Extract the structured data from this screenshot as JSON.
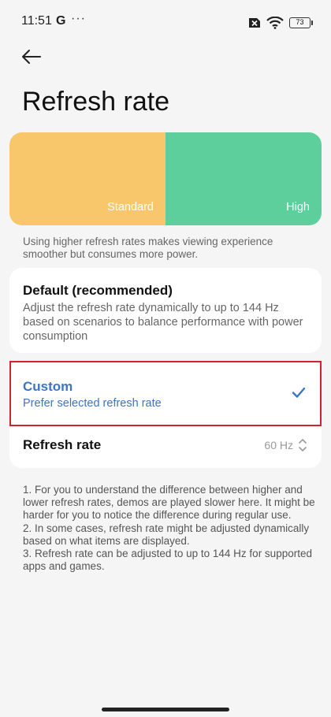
{
  "status_bar": {
    "time": "11:51",
    "google_letter": "G",
    "more": "···",
    "battery_level": "73"
  },
  "header": {
    "title": "Refresh rate"
  },
  "preview": {
    "standard_label": "Standard",
    "high_label": "High",
    "standard_color": "#f8c76c",
    "high_color": "#5ccf9c"
  },
  "description": "Using higher refresh rates makes viewing experience smoother but consumes more power.",
  "options": {
    "default": {
      "title": "Default (recommended)",
      "subtitle": "Adjust the refresh rate dynamically to up to 144 Hz based on scenarios to balance performance with power consumption"
    },
    "custom": {
      "title": "Custom",
      "subtitle": "Prefer selected refresh rate",
      "selected": true,
      "accent_color": "#3c74c6"
    }
  },
  "refresh_rate_row": {
    "label": "Refresh rate",
    "value": "60 Hz"
  },
  "notes": [
    "1. For you to understand the difference between higher and lower refresh rates, demos are played slower here. It might be harder for you to notice the difference during regular use.",
    "2. In some cases, refresh rate might be adjusted dynamically based on what items are displayed.",
    "3. Refresh rate can be adjusted to up to 144 Hz for supported apps and games."
  ],
  "highlight_color": "#d2222d"
}
